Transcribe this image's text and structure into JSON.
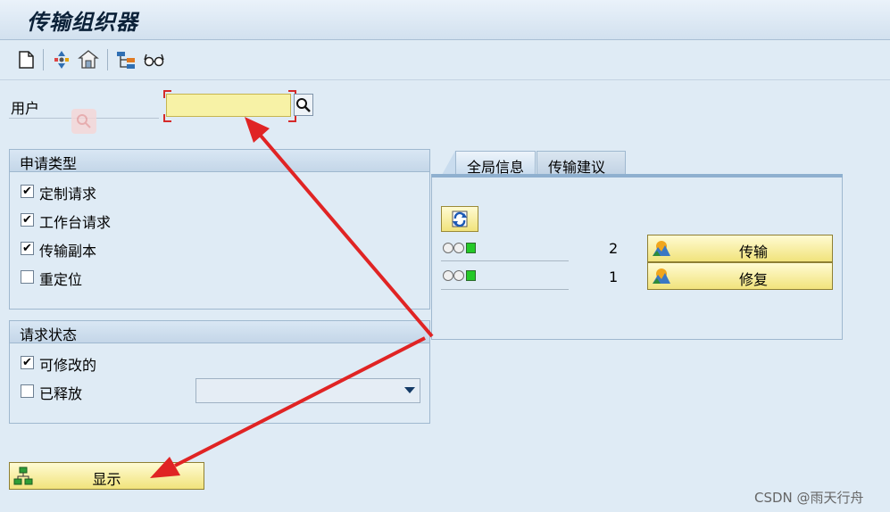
{
  "window": {
    "title": "传输组织器"
  },
  "toolbar": {
    "icons": [
      "new-document-icon",
      "transport-icon",
      "organizer-icon",
      "hierarchy-icon",
      "glasses-icon"
    ]
  },
  "user_field": {
    "label": "用户",
    "value": ""
  },
  "request_type": {
    "title": "申请类型",
    "items": [
      {
        "label": "定制请求",
        "checked": true
      },
      {
        "label": "工作台请求",
        "checked": true
      },
      {
        "label": "传输副本",
        "checked": true
      },
      {
        "label": "重定位",
        "checked": false
      }
    ]
  },
  "request_status": {
    "title": "请求状态",
    "items": [
      {
        "label": "可修改的",
        "checked": true
      },
      {
        "label": "已释放",
        "checked": false
      }
    ],
    "dropdown_value": ""
  },
  "tabs": [
    {
      "label": "全局信息",
      "active": true
    },
    {
      "label": "传输建议",
      "active": false
    }
  ],
  "global_info": {
    "rows": [
      {
        "count": "2",
        "button": "传输"
      },
      {
        "count": "1",
        "button": "修复"
      }
    ]
  },
  "display_button": {
    "label": "显示"
  },
  "watermark": "CSDN @雨天行舟",
  "colors": {
    "input_bg": "#f7f2a6",
    "button_bg": "#f1e37c",
    "arrow": "#e02424",
    "status_green": "#24c928"
  }
}
